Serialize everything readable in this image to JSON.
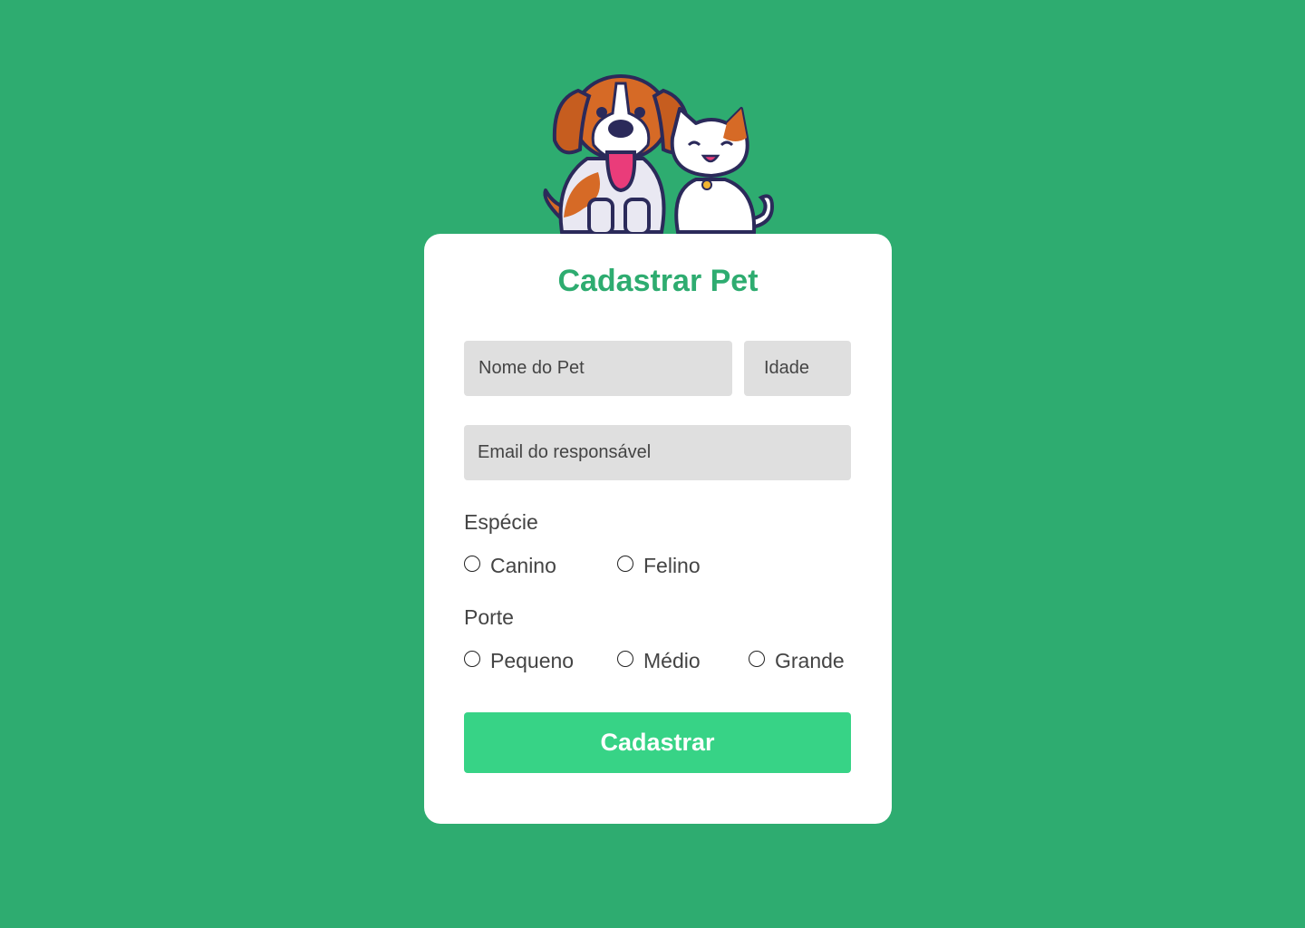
{
  "page": {
    "background_color": "#2eac70",
    "mascot_icon": "dog-and-cat-illustration"
  },
  "form": {
    "title": "Cadastrar Pet",
    "name_placeholder": "Nome do Pet",
    "age_placeholder": "Idade",
    "email_placeholder": "Email do responsável",
    "species": {
      "label": "Espécie",
      "options": [
        "Canino",
        "Felino"
      ]
    },
    "size": {
      "label": "Porte",
      "options": [
        "Pequeno",
        "Médio",
        "Grande"
      ]
    },
    "submit_label": "Cadastrar",
    "title_color": "#2eac70",
    "button_color": "#37d386"
  }
}
